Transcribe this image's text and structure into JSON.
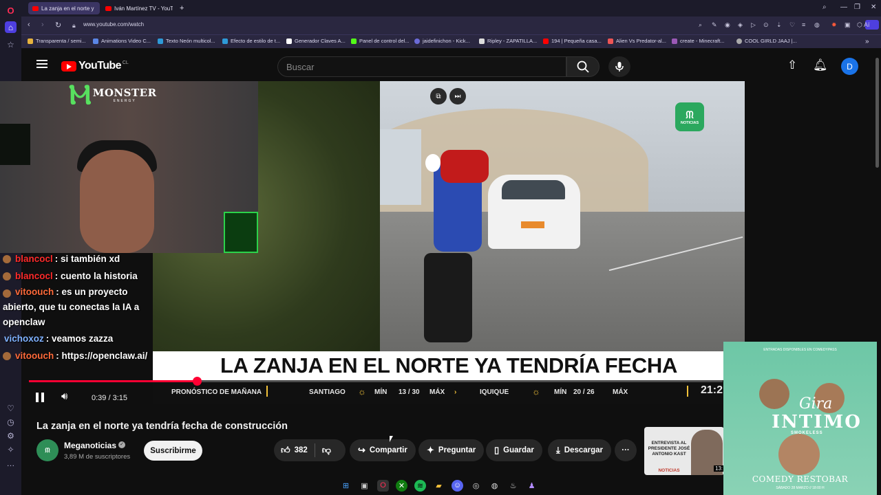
{
  "browser": {
    "tabs": [
      {
        "title": "La zanja en el norte y"
      },
      {
        "title": "Iván Martínez TV - YouTub"
      }
    ],
    "url": "www.youtube.com/watch",
    "ai_label": "Aï",
    "bookmarks": [
      "Transparenta / semi...",
      "Animations Video C...",
      "Texto Neón multicol...",
      "Efecto de estilo de t...",
      "Generador Claves A...",
      "Panel de control del...",
      "jaidefinichon - Kick...",
      "Ripley - ZAPATILLA...",
      "194 | Pequeña casa...",
      "Alien Vs Predator-al...",
      "create - Minecraft...",
      "COOL GIRLD JAAJ |..."
    ]
  },
  "header": {
    "logo": "YouTube",
    "country": "CL",
    "search_placeholder": "Buscar",
    "avatar_letter": "D"
  },
  "overlay": {
    "brand": "MONSTER",
    "brand_sub": "ENERGY",
    "chat": [
      {
        "user": "blancocl",
        "message": ": si también xd",
        "color": "#ff2b2b"
      },
      {
        "user": "blancocl",
        "message": ": cuento la historia",
        "color": "#ff2b2b"
      },
      {
        "user": "vitoouch",
        "message": ": es un proyecto abierto, que tu conectas la IA a openclaw",
        "color": "#ff6a3a"
      },
      {
        "user": "vichoxoz",
        "message": ": veamos zazza",
        "color": "#7fb2ff"
      },
      {
        "user": "vitoouch",
        "message": ": https://openclaw.ai/",
        "color": "#ff6a3a"
      }
    ]
  },
  "video": {
    "news_logo_text": "NOTICIAS",
    "headline": "LA ZANJA EN EL NORTE YA TENDRÍA FECHA",
    "forecast": {
      "label": "PRONÓSTICO DE MAÑANA",
      "city1": "SANTIAGO",
      "min_label": "MÍN",
      "max_label": "MÁX",
      "city1_temps": "13 / 30",
      "city2": "IQUIQUE",
      "city2_temps": "20 / 26",
      "clock": "21:2"
    },
    "time": "0:39 / 3:15",
    "progress_fraction": 0.242
  },
  "meta": {
    "title": "La zanja en el norte ya tendría fecha de construcción",
    "channel": "Meganoticias",
    "subscribers": "3,89 M de suscriptores",
    "subscribe_label": "Suscribirme",
    "likes": "382",
    "share_label": "Compartir",
    "ask_label": "Preguntar",
    "save_label": "Guardar",
    "download_label": "Descargar",
    "more_label": "···"
  },
  "recommendation": {
    "thumb_text": "ENTREVISTA AL PRESIDENTE JOSÉ ANTONIO KAST",
    "thumb_brand": "NOTICIAS",
    "duration": "13:"
  },
  "poster": {
    "top_text": "ENTRADAS DISPONIBLES EN COMEDYPASS",
    "gira": "Gira",
    "title": "INTIMO",
    "subtitle": "SMOKELESS",
    "venue": "COMEDY RESTOBAR",
    "date": "SÁBADO 28 MARZO // 18:00 H"
  },
  "colors": {
    "accent": "#ff0033",
    "subscribe_bg": "#f1f1f1",
    "avatar": "#1a73e8"
  }
}
